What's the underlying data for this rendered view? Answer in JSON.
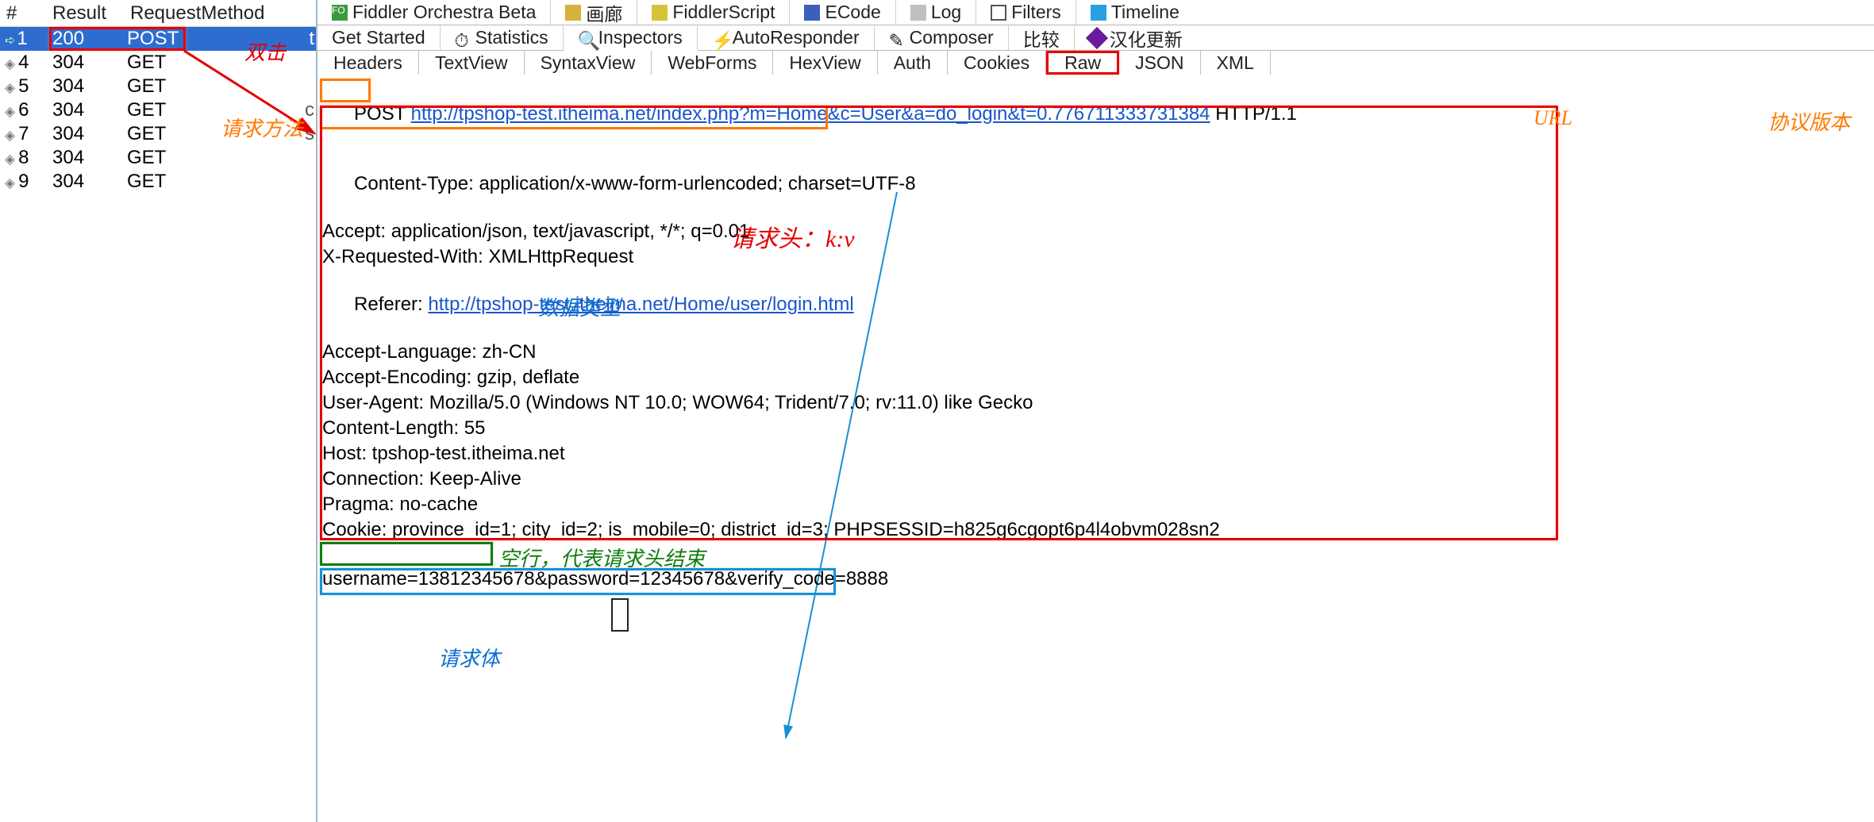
{
  "sessions": {
    "header": {
      "num": "#",
      "result": "Result",
      "method": "RequestMethod"
    },
    "rows": [
      {
        "num": "1",
        "result": "200",
        "method": "POST",
        "iconClass": "arrow-icon",
        "selected": true,
        "tail": "t"
      },
      {
        "num": "4",
        "result": "304",
        "method": "GET",
        "iconClass": "diamond"
      },
      {
        "num": "5",
        "result": "304",
        "method": "GET",
        "iconClass": "diamond"
      },
      {
        "num": "6",
        "result": "304",
        "method": "GET",
        "iconClass": "diamond",
        "tail": "c"
      },
      {
        "num": "7",
        "result": "304",
        "method": "GET",
        "iconClass": "diamond",
        "tail": "s"
      },
      {
        "num": "8",
        "result": "304",
        "method": "GET",
        "iconClass": "diamond"
      },
      {
        "num": "9",
        "result": "304",
        "method": "GET",
        "iconClass": "diamond"
      }
    ]
  },
  "top_tabs": [
    {
      "label": "Fiddler Orchestra Beta",
      "icon": "icon-fo",
      "iconText": "FO"
    },
    {
      "label": "画廊",
      "icon": "icon-gallery"
    },
    {
      "label": "FiddlerScript",
      "icon": "icon-script"
    },
    {
      "label": "ECode",
      "icon": "icon-ecode"
    },
    {
      "label": "Log",
      "icon": "icon-log"
    },
    {
      "label": "Filters",
      "icon": "icon-filter"
    },
    {
      "label": "Timeline",
      "icon": "icon-timeline"
    }
  ],
  "second_tabs": [
    {
      "label": "Get Started"
    },
    {
      "label": "Statistics",
      "icon": "icon-stats"
    },
    {
      "label": "Inspectors",
      "icon": "icon-insp",
      "active": true
    },
    {
      "label": "AutoResponder",
      "icon": "icon-ar"
    },
    {
      "label": "Composer",
      "icon": "icon-comp"
    },
    {
      "label": "比较"
    },
    {
      "label": "汉化更新",
      "icon": "icon-update"
    }
  ],
  "insp_tabs": [
    "Headers",
    "TextView",
    "SyntaxView",
    "WebForms",
    "HexView",
    "Auth",
    "Cookies",
    "Raw",
    "JSON",
    "XML"
  ],
  "insp_active": "Raw",
  "request": {
    "method": "POST",
    "url": "http://tpshop-test.itheima.net/index.php?m=Home&c=User&a=do_login&t=0.776711333731384",
    "http_ver": "HTTP/1.1",
    "content_type_key": "Content-Type:",
    "content_type_val": "application/x-www-form-urlencoded; charset=UTF-8",
    "headers": [
      "Accept: application/json, text/javascript, */*; q=0.01",
      "X-Requested-With: XMLHttpRequest"
    ],
    "referer_key": "Referer: ",
    "referer_url": "http://tpshop-test.itheima.net/Home/user/login.html",
    "headers2": [
      "Accept-Language: zh-CN",
      "Accept-Encoding: gzip, deflate",
      "User-Agent: Mozilla/5.0 (Windows NT 10.0; WOW64; Trident/7.0; rv:11.0) like Gecko",
      "Content-Length: 55",
      "Host: tpshop-test.itheima.net",
      "Connection: Keep-Alive",
      "Pragma: no-cache",
      "Cookie: province_id=1; city_id=2; is_mobile=0; district_id=3; PHPSESSID=h825g6cgopt6p4l4obvm028sn2"
    ],
    "body": "username=13812345678&password=12345678&verify_code=8888"
  },
  "anno": {
    "dblclick": "双击",
    "req_method": "请求方法",
    "url": "URL",
    "proto": "协议版本",
    "headers_kv": "请求头：k:v",
    "datatype": "数据类型",
    "empty_line": "空行，代表请求头结束",
    "body": "请求体"
  }
}
